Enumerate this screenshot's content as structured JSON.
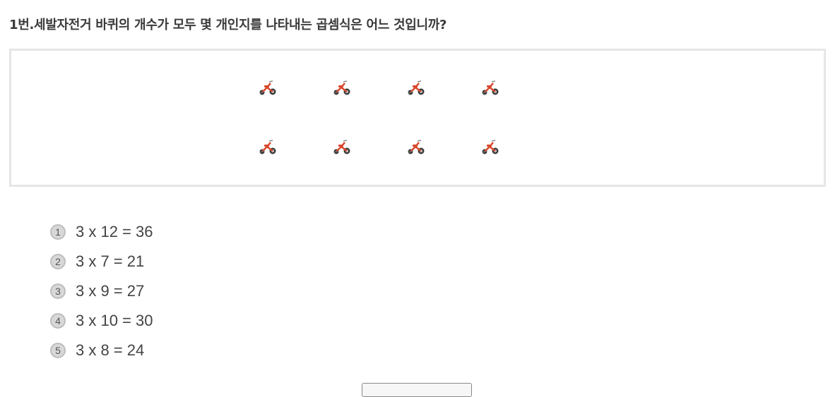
{
  "question": {
    "title": "1번.세발자전거 바퀴의 개수가 모두 몇 개인지를 나타내는 곱셈식은 어느 것입니까?"
  },
  "picture": {
    "rows": [
      [
        "tricycle-icon",
        "tricycle-icon",
        "tricycle-icon",
        "tricycle-icon"
      ],
      [
        "tricycle-icon",
        "tricycle-icon",
        "tricycle-icon",
        "tricycle-icon"
      ]
    ],
    "colors": {
      "frame": "#d9472b",
      "wheel": "#3b3b3b",
      "box_border": "#e6e6e6"
    }
  },
  "options": [
    {
      "number": "1",
      "text": "3 x 12 = 36"
    },
    {
      "number": "2",
      "text": "3 x 7 = 21"
    },
    {
      "number": "3",
      "text": "3 x 9 = 27"
    },
    {
      "number": "4",
      "text": "3 x 10 = 30"
    },
    {
      "number": "5",
      "text": "3 x 8 = 24"
    }
  ]
}
